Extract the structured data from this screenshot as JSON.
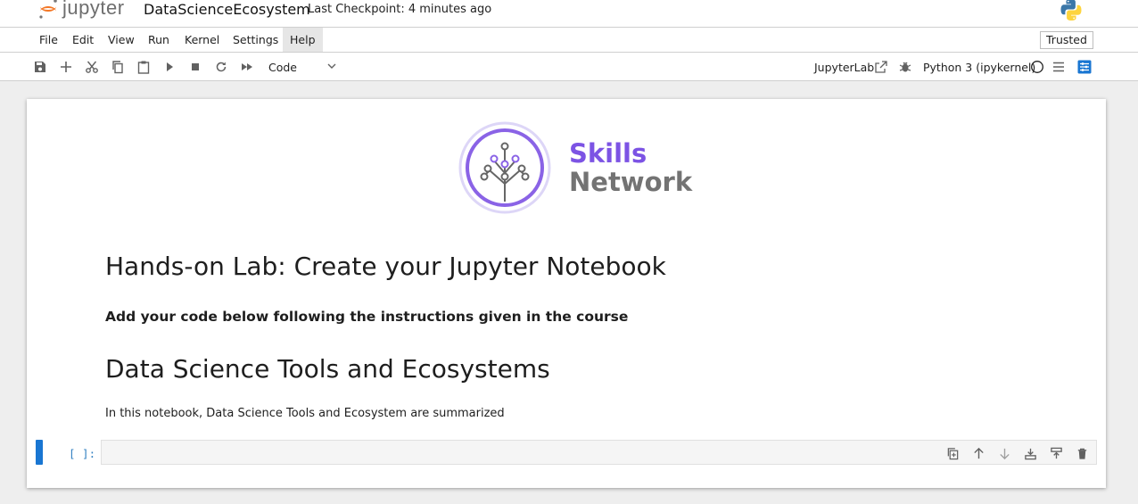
{
  "header": {
    "logo_text": "jupyter",
    "notebook_title": "DataScienceEcosystem",
    "checkpoint": "Last Checkpoint: 4 minutes ago"
  },
  "menubar": {
    "items": [
      "File",
      "Edit",
      "View",
      "Run",
      "Kernel",
      "Settings",
      "Help"
    ],
    "active_item": "Help",
    "trusted_label": "Trusted"
  },
  "toolbar": {
    "buttons": [
      "save-icon",
      "add-icon",
      "cut-icon",
      "copy-icon",
      "paste-icon",
      "run-icon",
      "stop-icon",
      "restart-icon",
      "fast-forward-icon"
    ],
    "cell_type": "Code",
    "jupyterlab_label": "JupyterLab",
    "kernel_name": "Python 3 (ipykernel)"
  },
  "notebook": {
    "logo_line1": "Skills",
    "logo_line2": "Network",
    "heading1": "Hands-on Lab: Create your Jupyter Notebook",
    "heading4": "Add your code below following the instructions given in the course",
    "heading2": "Data Science Tools and Ecosystems",
    "paragraph": "In this notebook, Data Science Tools and Ecosystem are summarized",
    "code_prompt": "[ ]:",
    "cell_tools": [
      "duplicate-icon",
      "move-up-icon",
      "move-down-icon",
      "insert-above-icon",
      "insert-below-icon",
      "delete-icon"
    ]
  },
  "colors": {
    "accent": "#1976d2",
    "skills_purple": "#7c53e4",
    "network_gray": "#737373",
    "jupyter_orange": "#f37726"
  }
}
